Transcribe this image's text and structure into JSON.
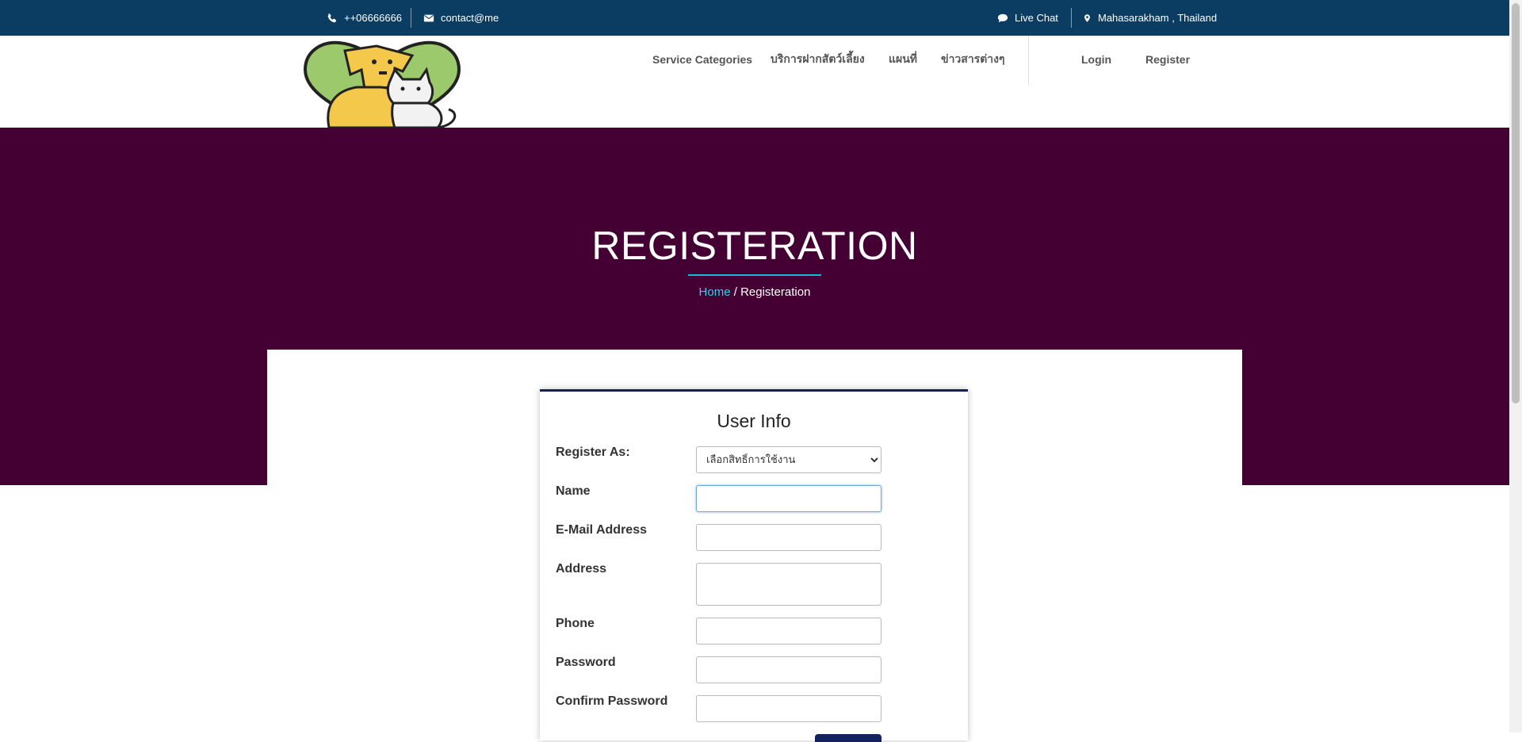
{
  "topbar": {
    "phone": "++06666666",
    "email": "contact@me",
    "live_chat": "Live Chat",
    "location": "Mahasarakham , Thailand"
  },
  "nav": {
    "items": [
      "Service Categories",
      "บริการฝากสัตว์เลี้ยง",
      "แผนที่",
      "ข่าวสารต่างๆ"
    ],
    "login": "Login",
    "register": "Register"
  },
  "hero": {
    "title": "REGISTERATION",
    "breadcrumb_home": "Home",
    "breadcrumb_sep": "/",
    "breadcrumb_current": "Registeration"
  },
  "form": {
    "title": "User Info",
    "register_as_label": "Register As:",
    "register_as_selected": "เลือกสิทธิ์การใช้งาน",
    "name_label": "Name",
    "email_label": "E-Mail Address",
    "address_label": "Address",
    "phone_label": "Phone",
    "password_label": "Password",
    "confirm_password_label": "Confirm Password"
  },
  "colors": {
    "topbar": "#0b3d63",
    "hero": "#440033",
    "accent": "#18b9d4",
    "card_border": "#13215e"
  },
  "icons": [
    "phone-icon",
    "envelope-icon",
    "chat-bubble-icon",
    "map-marker-icon"
  ]
}
